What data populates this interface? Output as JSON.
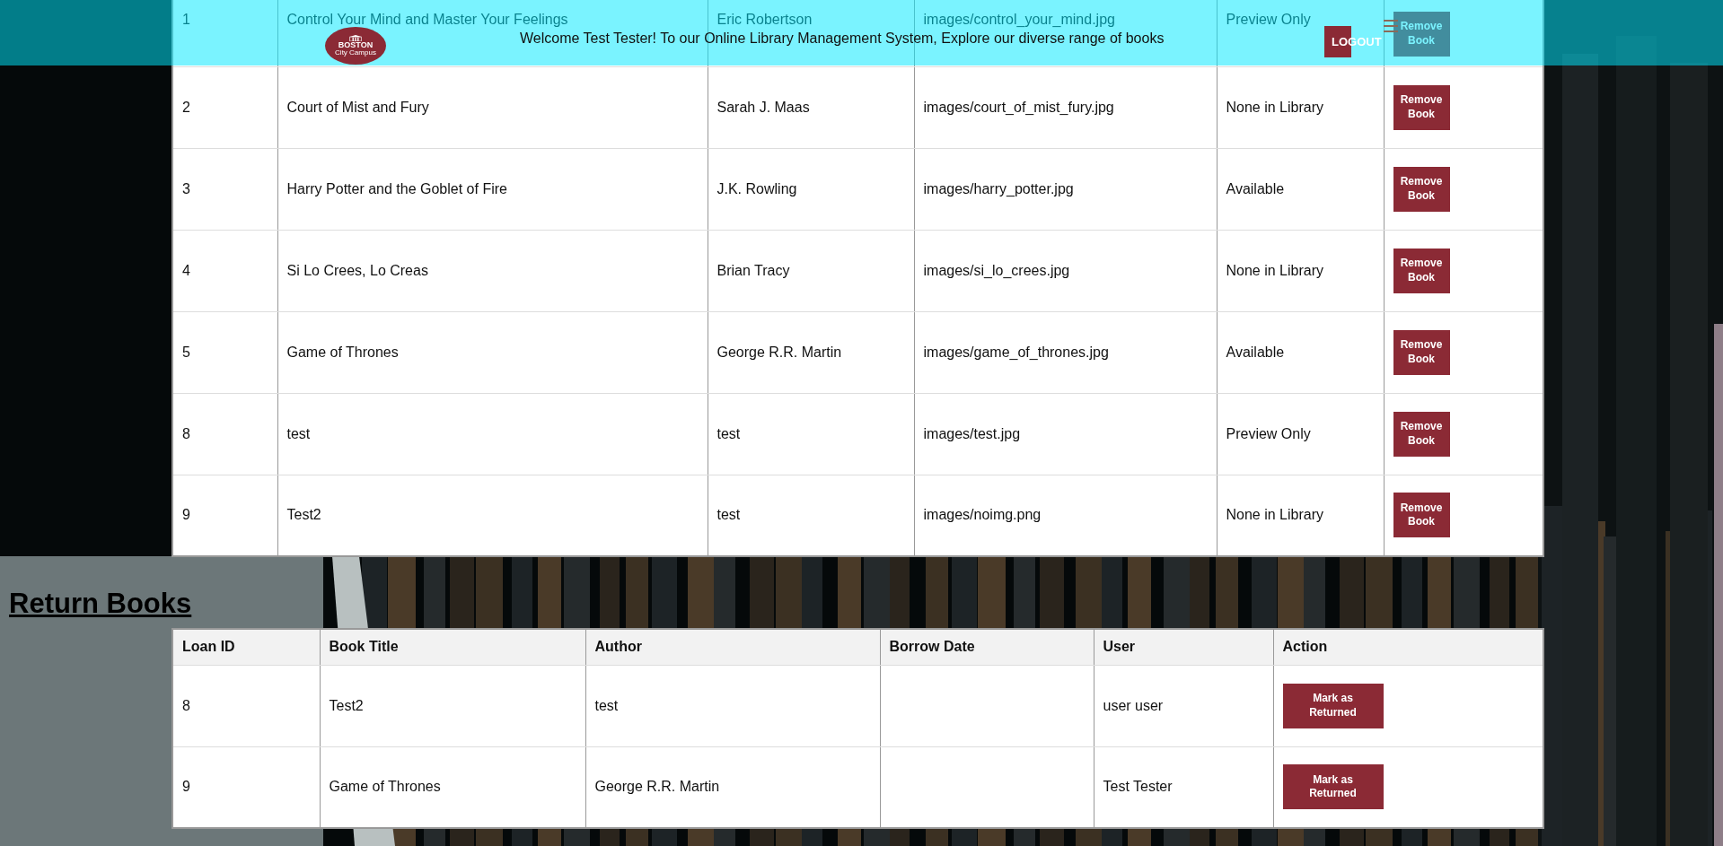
{
  "header": {
    "logo_name": "BOSTON",
    "logo_sub": "City Campus",
    "welcome": "Welcome Test Tester! To our Online Library Management System, Explore our diverse range of books",
    "logout": "LOGOUT"
  },
  "books": {
    "rows": [
      {
        "id": "1",
        "title": "Control Your Mind and Master Your Feelings",
        "author": "Eric Robertson",
        "image": "images/control_your_mind.jpg",
        "availability": "Preview Only",
        "action": "Remove Book"
      },
      {
        "id": "2",
        "title": "Court of Mist and Fury",
        "author": "Sarah J. Maas",
        "image": "images/court_of_mist_fury.jpg",
        "availability": "None in Library",
        "action": "Remove Book"
      },
      {
        "id": "3",
        "title": "Harry Potter and the Goblet of Fire",
        "author": "J.K. Rowling",
        "image": "images/harry_potter.jpg",
        "availability": "Available",
        "action": "Remove Book"
      },
      {
        "id": "4",
        "title": "Si Lo Crees, Lo Creas",
        "author": "Brian Tracy",
        "image": "images/si_lo_crees.jpg",
        "availability": "None in Library",
        "action": "Remove Book"
      },
      {
        "id": "5",
        "title": "Game of Thrones",
        "author": "George R.R. Martin",
        "image": "images/game_of_thrones.jpg",
        "availability": "Available",
        "action": "Remove Book"
      },
      {
        "id": "8",
        "title": "test",
        "author": "test",
        "image": "images/test.jpg",
        "availability": "Preview Only",
        "action": "Remove Book"
      },
      {
        "id": "9",
        "title": "Test2",
        "author": "test",
        "image": "images/noimg.png",
        "availability": "None in Library",
        "action": "Remove Book"
      }
    ]
  },
  "returns": {
    "heading": "Return Books",
    "columns": [
      "Loan ID",
      "Book Title",
      "Author",
      "Borrow Date",
      "User",
      "Action"
    ],
    "rows": [
      {
        "loan_id": "8",
        "title": "Test2",
        "author": "test",
        "user": "user user",
        "action": "Mark as Returned"
      },
      {
        "loan_id": "9",
        "title": "Game of Thrones",
        "author": "George R.R. Martin",
        "user": "Test Tester",
        "action": "Mark as Returned"
      }
    ]
  }
}
